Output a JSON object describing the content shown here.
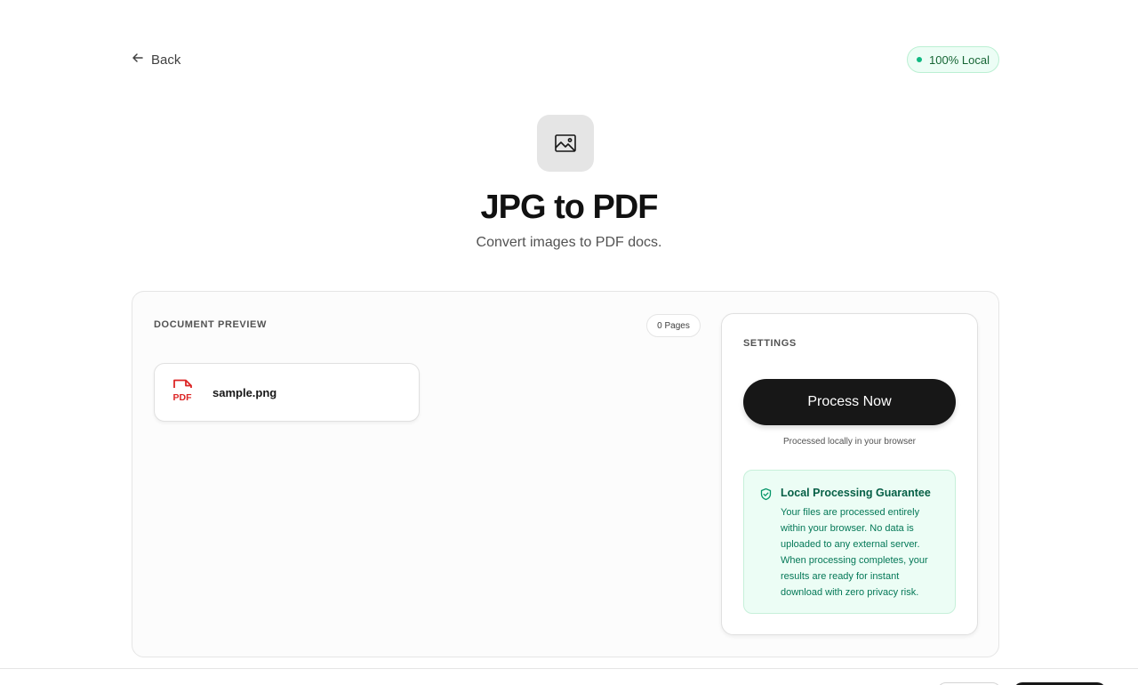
{
  "nav": {
    "back_label": "Back"
  },
  "badge": {
    "label": "100% Local",
    "dot_color": "#10b981"
  },
  "hero": {
    "icon": "image-icon",
    "title": "JPG to PDF",
    "subtitle": "Convert images to PDF docs."
  },
  "preview": {
    "label": "DOCUMENT PREVIEW",
    "pages_chip": "0 Pages",
    "files": [
      {
        "name": "sample.png",
        "icon": "pdf-file-icon",
        "icon_text": "PDF",
        "icon_color": "#dc2626"
      }
    ]
  },
  "settings": {
    "label": "SETTINGS",
    "process_button": "Process Now",
    "process_note": "Processed locally in your browser",
    "guarantee": {
      "icon": "shield-check-icon",
      "title": "Local Processing Guarantee",
      "body": "Your files are processed entirely within your browser. No data is uploaded to any external server. When processing completes, your results are ready for instant download with zero privacy risk."
    }
  }
}
